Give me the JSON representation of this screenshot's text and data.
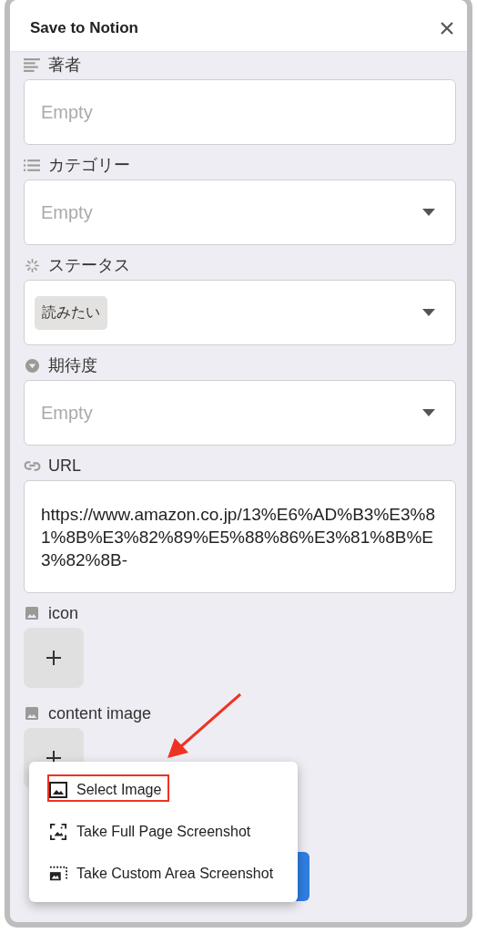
{
  "window": {
    "title": "Save to Notion"
  },
  "fields": [
    {
      "kind": "text",
      "label": "著者",
      "placeholder": "Empty"
    },
    {
      "kind": "multi_select",
      "label": "カテゴリー",
      "placeholder": "Empty"
    },
    {
      "kind": "status",
      "label": "ステータス",
      "value": "読みたい"
    },
    {
      "kind": "select",
      "label": "期待度",
      "placeholder": "Empty"
    },
    {
      "kind": "url",
      "label": "URL",
      "value": "https://www.amazon.co.jp/13%E6%AD%B3%E3%81%8B%E3%82%89%E5%88%86%E3%81%8B%E3%82%8B-"
    },
    {
      "kind": "files",
      "label": "icon"
    },
    {
      "kind": "files",
      "label": "content image"
    }
  ],
  "menu": {
    "items": [
      {
        "kind": "select",
        "label": "Select Image",
        "highlighted": true
      },
      {
        "kind": "full",
        "label": "Take Full Page Screenshot",
        "highlighted": false
      },
      {
        "kind": "area",
        "label": "Take Custom Area Screenshot",
        "highlighted": false
      }
    ]
  }
}
